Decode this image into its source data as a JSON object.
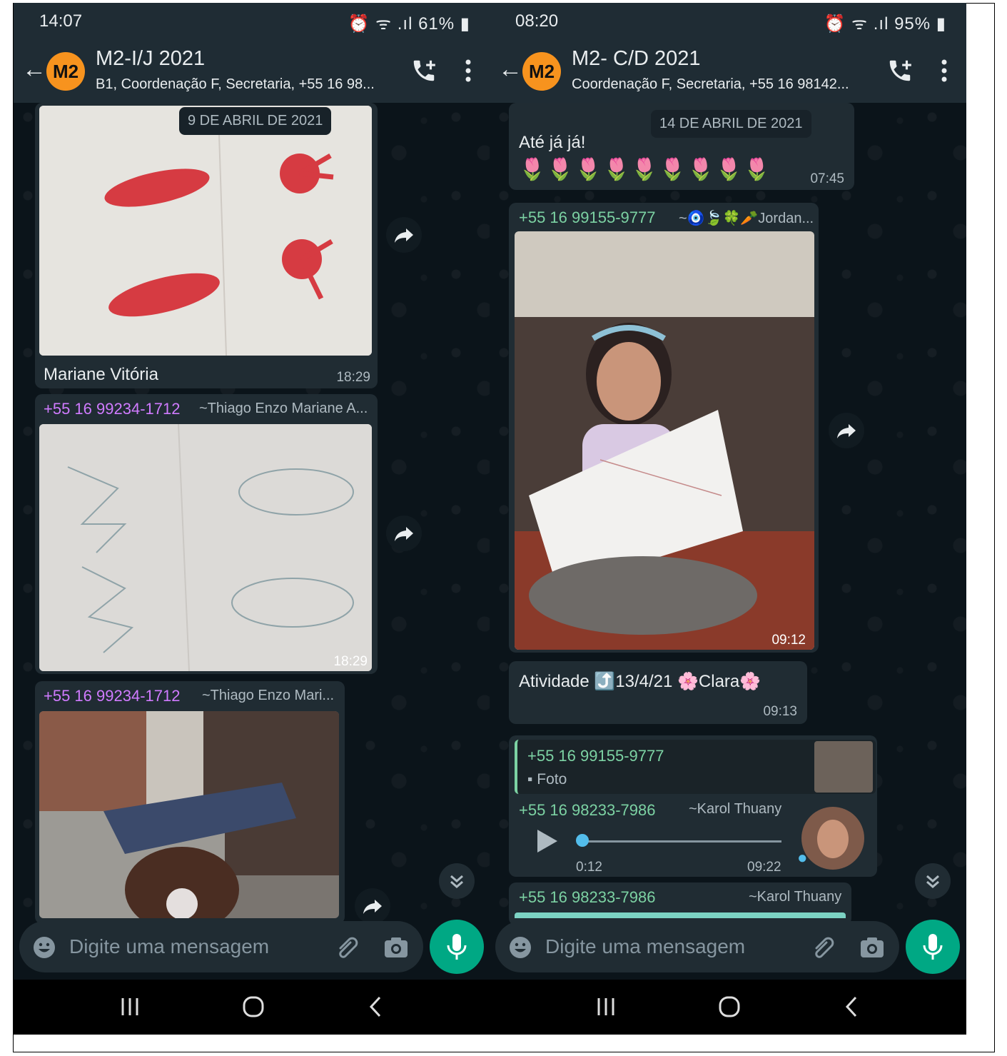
{
  "left": {
    "status": {
      "time": "14:07",
      "battery": "61%"
    },
    "chat": {
      "title": "M2-I/J 2021",
      "subtitle": "B1, Coordenação F, Secretaria, +55 16 98...",
      "avatar": "M2"
    },
    "date_chip": "9 DE ABRIL DE 2021",
    "messages": [
      {
        "caption": "Mariane Vitória",
        "time": "18:29"
      },
      {
        "sender": "+55 16 99234-1712",
        "pushname": "~Thiago Enzo Mariane A...",
        "time": "18:29"
      },
      {
        "sender": "+55 16 99234-1712",
        "pushname": "~Thiago Enzo Mari..."
      }
    ],
    "composer_placeholder": "Digite uma mensagem"
  },
  "right": {
    "status": {
      "time": "08:20",
      "battery": "95%"
    },
    "chat": {
      "title": "M2- C/D 2021",
      "subtitle": "Coordenação F, Secretaria, +55 16 98142...",
      "avatar": "M2"
    },
    "date_chip": "14 DE ABRIL DE 2021",
    "messages": [
      {
        "text": "Até já já!",
        "emojis": "🌷🌷🌷🌷🌷🌷🌷🌷🌷",
        "time": "07:45"
      },
      {
        "sender": "+55 16 99155-9777",
        "pushname": "~🧿🍃🍀🥕Jordan...",
        "time": "09:12"
      },
      {
        "text": "Atividade ⤴️13/4/21 🌸Clara🌸",
        "time": "09:13"
      },
      {
        "quote_sender": "+55 16 99155-9777",
        "quote_type": "Foto",
        "sender": "+55 16 98233-7986",
        "pushname": "~Karol Thuany",
        "duration": "0:12",
        "time": "09:22"
      },
      {
        "sender": "+55 16 98233-7986",
        "pushname": "~Karol Thuany"
      }
    ],
    "composer_placeholder": "Digite uma mensagem"
  },
  "colors": {
    "header": "#1f2c34",
    "chat_bg": "#0b141a",
    "bubble": "#202c33",
    "accent": "#00a884",
    "avatar": "#f7931e"
  },
  "icons": [
    "back-arrow-icon",
    "add-call-icon",
    "more-vertical-icon",
    "forward-icon",
    "scroll-down-icon",
    "emoji-icon",
    "attach-icon",
    "camera-icon",
    "mic-icon",
    "play-icon",
    "nav-recent-icon",
    "nav-home-icon",
    "nav-back-icon"
  ]
}
